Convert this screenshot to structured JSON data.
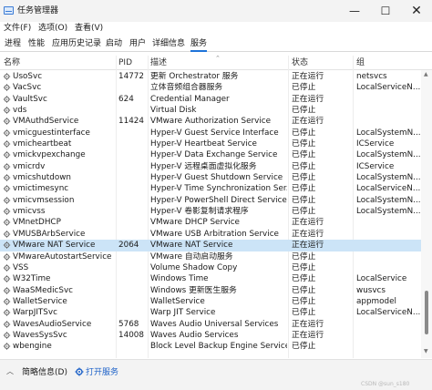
{
  "window": {
    "title": "任务管理器",
    "minimize": "—",
    "maximize": "☐",
    "close": "✕"
  },
  "menu": {
    "items": [
      "文件(F)",
      "选项(O)",
      "查看(V)"
    ]
  },
  "tabs": [
    "进程",
    "性能",
    "应用历史记录",
    "启动",
    "用户",
    "详细信息",
    "服务"
  ],
  "active_tab": "服务",
  "columns": {
    "name": "名称",
    "pid": "PID",
    "description": "描述",
    "status": "状态",
    "group": "组"
  },
  "services": [
    {
      "name": "UsoSvc",
      "pid": "14772",
      "description": "更新 Orchestrator 服务",
      "status": "正在运行",
      "group": "netsvcs"
    },
    {
      "name": "VacSvc",
      "pid": "",
      "description": "立体音频组合器服务",
      "status": "已停止",
      "group": "LocalServiceN..."
    },
    {
      "name": "VaultSvc",
      "pid": "624",
      "description": "Credential Manager",
      "status": "正在运行",
      "group": ""
    },
    {
      "name": "vds",
      "pid": "",
      "description": "Virtual Disk",
      "status": "已停止",
      "group": ""
    },
    {
      "name": "VMAuthdService",
      "pid": "11424",
      "description": "VMware Authorization Service",
      "status": "正在运行",
      "group": ""
    },
    {
      "name": "vmicguestinterface",
      "pid": "",
      "description": "Hyper-V Guest Service Interface",
      "status": "已停止",
      "group": "LocalSystemN..."
    },
    {
      "name": "vmicheartbeat",
      "pid": "",
      "description": "Hyper-V Heartbeat Service",
      "status": "已停止",
      "group": "ICService"
    },
    {
      "name": "vmickvpexchange",
      "pid": "",
      "description": "Hyper-V Data Exchange Service",
      "status": "已停止",
      "group": "LocalSystemN..."
    },
    {
      "name": "vmicrdv",
      "pid": "",
      "description": "Hyper-V 远程桌面虚拟化服务",
      "status": "已停止",
      "group": "ICService"
    },
    {
      "name": "vmicshutdown",
      "pid": "",
      "description": "Hyper-V Guest Shutdown Service",
      "status": "已停止",
      "group": "LocalSystemN..."
    },
    {
      "name": "vmictimesync",
      "pid": "",
      "description": "Hyper-V Time Synchronization Ser...",
      "status": "已停止",
      "group": "LocalServiceN..."
    },
    {
      "name": "vmicvmsession",
      "pid": "",
      "description": "Hyper-V PowerShell Direct Service",
      "status": "已停止",
      "group": "LocalSystemN..."
    },
    {
      "name": "vmicvss",
      "pid": "",
      "description": "Hyper-V 卷影复制请求程序",
      "status": "已停止",
      "group": "LocalSystemN..."
    },
    {
      "name": "VMnetDHCP",
      "pid": "",
      "description": "VMware DHCP Service",
      "status": "正在运行",
      "group": ""
    },
    {
      "name": "VMUSBArbService",
      "pid": "",
      "description": "VMware USB Arbitration Service",
      "status": "正在运行",
      "group": ""
    },
    {
      "name": "VMware NAT Service",
      "pid": "2064",
      "description": "VMware NAT Service",
      "status": "正在运行",
      "group": ""
    },
    {
      "name": "VMwareAutostartService",
      "pid": "",
      "description": "VMware 自动启动服务",
      "status": "已停止",
      "group": ""
    },
    {
      "name": "VSS",
      "pid": "",
      "description": "Volume Shadow Copy",
      "status": "已停止",
      "group": ""
    },
    {
      "name": "W32Time",
      "pid": "",
      "description": "Windows Time",
      "status": "已停止",
      "group": "LocalService"
    },
    {
      "name": "WaaSMedicSvc",
      "pid": "",
      "description": "Windows 更新医生服务",
      "status": "已停止",
      "group": "wusvcs"
    },
    {
      "name": "WalletService",
      "pid": "",
      "description": "WalletService",
      "status": "已停止",
      "group": "appmodel"
    },
    {
      "name": "WarpJITSvc",
      "pid": "",
      "description": "Warp JIT Service",
      "status": "已停止",
      "group": "LocalServiceN..."
    },
    {
      "name": "WavesAudioService",
      "pid": "5768",
      "description": "Waves Audio Universal Services",
      "status": "正在运行",
      "group": ""
    },
    {
      "name": "WavesSysSvc",
      "pid": "14008",
      "description": "Waves Audio Services",
      "status": "正在运行",
      "group": ""
    },
    {
      "name": "wbengine",
      "pid": "",
      "description": "Block Level Backup Engine Service",
      "status": "已停止",
      "group": ""
    }
  ],
  "selected_row": "VMware NAT Service",
  "footer": {
    "fewer_details": "简略信息(D)",
    "open_services": "打开服务"
  },
  "watermark": "CSDN @sun_s180",
  "colors": {
    "accent": "#1e73d9",
    "selected_row": "#cce4f7",
    "link": "#1e62c8"
  }
}
